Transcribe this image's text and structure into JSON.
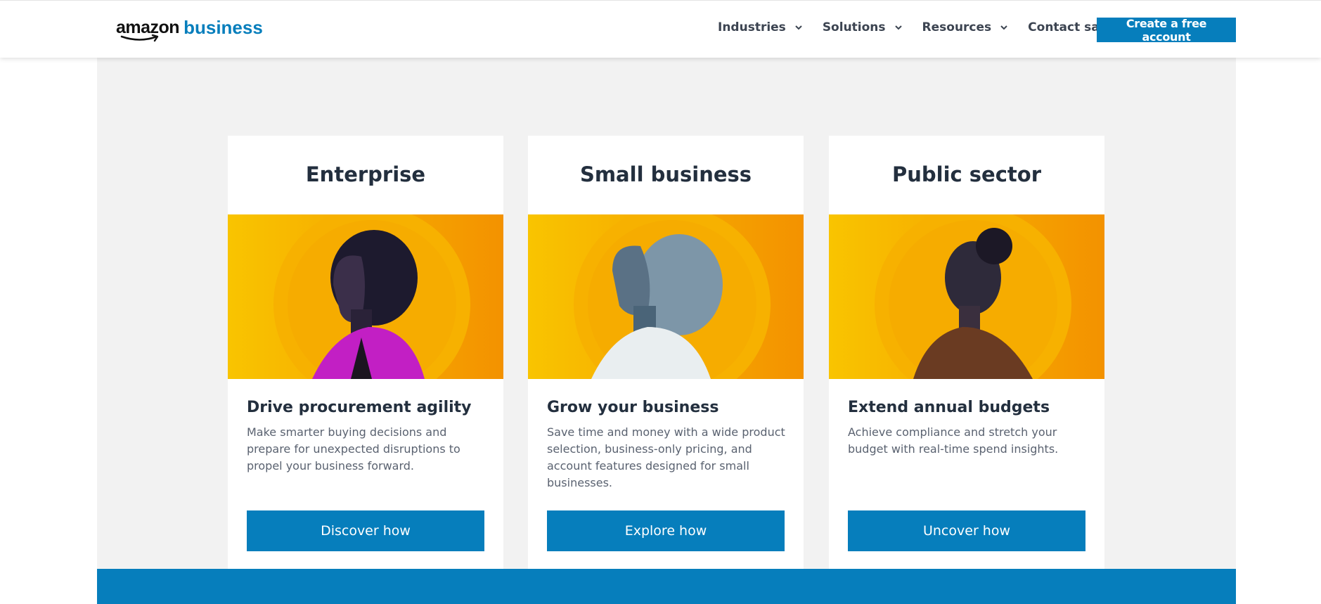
{
  "header": {
    "logo": {
      "amazon": "amazon",
      "business": "business"
    },
    "nav": [
      {
        "label": "Industries"
      },
      {
        "label": "Solutions"
      },
      {
        "label": "Resources"
      },
      {
        "label": "Contact sales"
      }
    ],
    "cta_label": "Create a free account"
  },
  "cards": [
    {
      "title": "Enterprise",
      "image_icon": "portrait-woman-magenta-blazer",
      "heading": "Drive procurement agility",
      "text": "Make smarter buying decisions and prepare for unexpected disruptions to propel your business forward.",
      "button": "Discover how"
    },
    {
      "title": "Small business",
      "image_icon": "portrait-woman-white-shirt",
      "heading": "Grow your business",
      "text": "Save time and money with a wide product selection, business-only pricing, and account features designed for small businesses.",
      "button": "Explore how"
    },
    {
      "title": "Public sector",
      "image_icon": "portrait-woman-brown-shirt",
      "heading": "Extend annual budgets",
      "text": "Achieve compliance and stretch your budget with real-time spend insights.",
      "button": "Uncover how"
    }
  ],
  "colors": {
    "brand_blue": "#067ebc",
    "section_bg": "#f2f2f2",
    "heading": "#232f3e",
    "body_text": "#5a6270",
    "image_yellow": "#f7b500",
    "image_orange": "#f39200"
  }
}
